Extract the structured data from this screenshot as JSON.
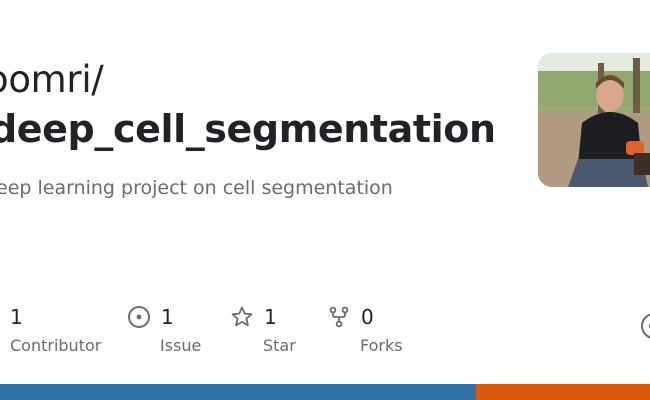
{
  "repo": {
    "owner": "oomri/",
    "name": "deep_cell_segmentation",
    "description": "eep learning project on cell segmentation"
  },
  "stats": [
    {
      "value": "1",
      "label": "Contributor",
      "icon": "people-icon"
    },
    {
      "value": "1",
      "label": "Issue",
      "icon": "issue-opened-icon"
    },
    {
      "value": "1",
      "label": "Star",
      "icon": "star-icon"
    },
    {
      "value": "0",
      "label": "Forks",
      "icon": "repo-forked-icon"
    }
  ],
  "avatar": {
    "icon": "user-avatar-photo"
  },
  "language_bar": [
    {
      "color": "#3572A5",
      "share": 0.733
    },
    {
      "color": "#DA5B0B",
      "share": 0.267
    }
  ],
  "colors": {
    "text_primary": "#1f2328",
    "text_secondary": "#656d76"
  }
}
